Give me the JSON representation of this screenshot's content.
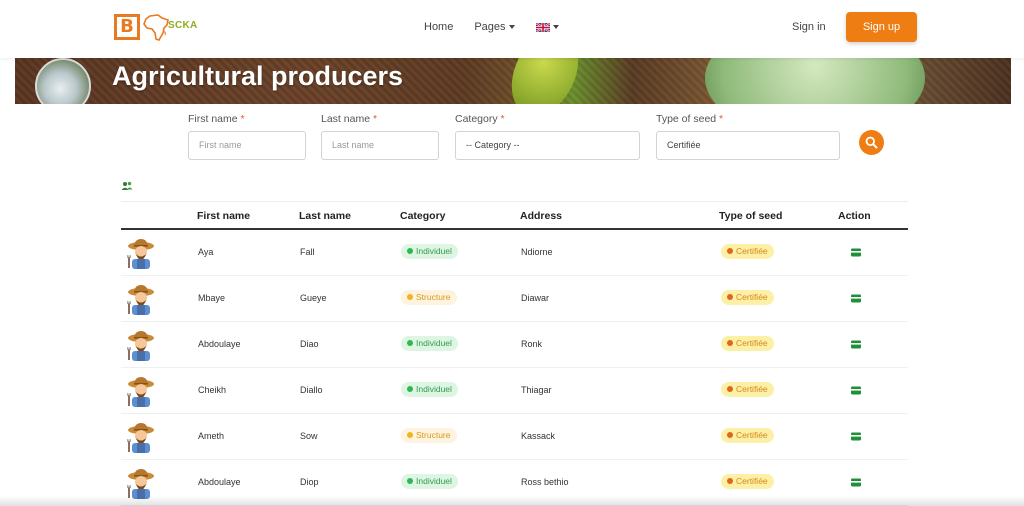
{
  "navbar": {
    "logo_letter": "B",
    "logo_text": "SCKA",
    "links": [
      {
        "label": "Home"
      },
      {
        "label": "Pages"
      }
    ],
    "sign_in": "Sign in",
    "sign_up": "Sign up",
    "accent_color": "#ee7d13"
  },
  "banner": {
    "title": "Agricultural producers"
  },
  "filters": {
    "first_name": {
      "label": "First name",
      "required": "*",
      "placeholder": "First name",
      "value": ""
    },
    "last_name": {
      "label": "Last name",
      "required": "*",
      "placeholder": "Last name",
      "value": ""
    },
    "category": {
      "label": "Category",
      "required": "*",
      "value": "-- Category --"
    },
    "seed": {
      "label": "Type of seed",
      "required": "*",
      "value": "Certifiée"
    }
  },
  "table": {
    "headers": [
      "First name",
      "Last name",
      "Category",
      "Address",
      "Type of seed",
      "Action"
    ],
    "rows": [
      {
        "first": "Aya",
        "last": "Fall",
        "category": "Individuel",
        "address": "Ndiorne",
        "seed": "Certifiée"
      },
      {
        "first": "Mbaye",
        "last": "Gueye",
        "category": "Structure",
        "address": "Diawar",
        "seed": "Certifiée"
      },
      {
        "first": "Abdoulaye",
        "last": "Diao",
        "category": "Individuel",
        "address": "Ronk",
        "seed": "Certifiée"
      },
      {
        "first": "Cheikh",
        "last": "Diallo",
        "category": "Individuel",
        "address": "Thiagar",
        "seed": "Certifiée"
      },
      {
        "first": "Ameth",
        "last": "Sow",
        "category": "Structure",
        "address": "Kassack",
        "seed": "Certifiée"
      },
      {
        "first": "Abdoulaye",
        "last": "Diop",
        "category": "Individuel",
        "address": "Ross bethio",
        "seed": "Certifiée"
      }
    ]
  }
}
